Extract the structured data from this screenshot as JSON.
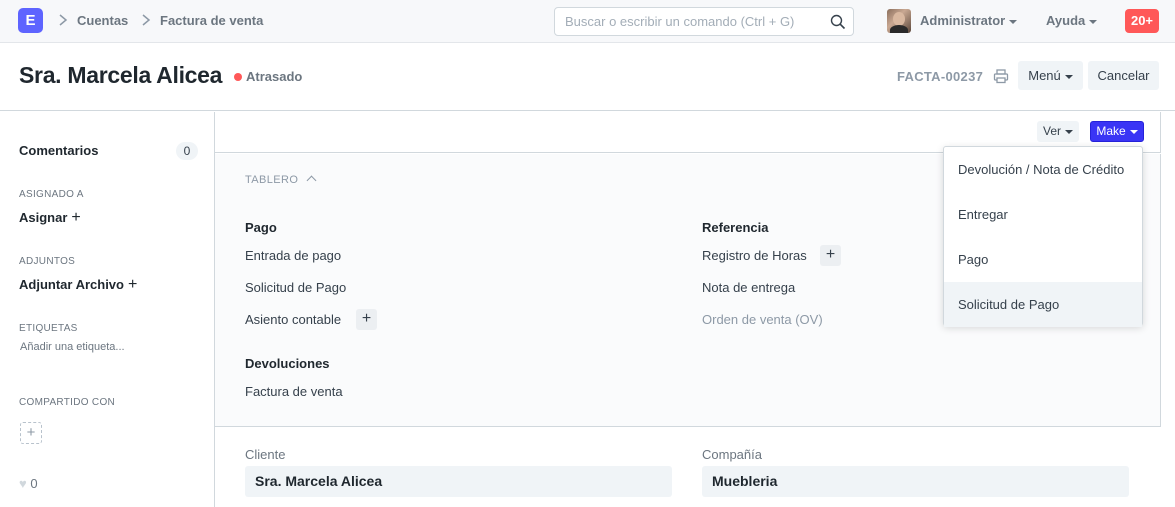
{
  "navbar": {
    "logo": "E",
    "breadcrumbs": [
      "Cuentas",
      "Factura de venta"
    ],
    "search_placeholder": "Buscar o escribir un comando (Ctrl + G)",
    "user": "Administrator",
    "help": "Ayuda",
    "notifications": "20+"
  },
  "page": {
    "title": "Sra. Marcela Alicea",
    "status": "Atrasado",
    "doc_id": "FACTA-00237",
    "menu_label": "Menú",
    "cancel_label": "Cancelar"
  },
  "sidebar": {
    "comments_label": "Comentarios",
    "comments_count": "0",
    "assigned_label": "ASIGNADO A",
    "assign_action": "Asignar",
    "attachments_label": "ADJUNTOS",
    "attach_action": "Adjuntar Archivo",
    "tags_label": "ETIQUETAS",
    "tags_placeholder": "Añadir una etiqueta...",
    "shared_label": "COMPARTIDO CON",
    "likes": "0"
  },
  "toolbar": {
    "view_label": "Ver",
    "make_label": "Make"
  },
  "dashboard": {
    "title": "TABLERO",
    "groups": [
      {
        "title": "Pago",
        "items": [
          "Entrada de pago",
          "Solicitud de Pago",
          "Asiento contable"
        ]
      },
      {
        "title": "Referencia",
        "items": [
          "Registro de Horas",
          "Nota de entrega",
          "Orden de venta (OV)"
        ]
      },
      {
        "title": "Devoluciones",
        "items": [
          "Factura de venta"
        ]
      }
    ]
  },
  "form": {
    "customer_label": "Cliente",
    "customer_value": "Sra. Marcela Alicea",
    "company_label": "Compañía",
    "company_value": "Muebleria"
  },
  "make_menu": {
    "items": [
      "Devolución / Nota de Crédito",
      "Entregar",
      "Pago",
      "Solicitud de Pago"
    ],
    "highlighted": "Solicitud de Pago"
  },
  "colors": {
    "brand": "#5e64ff",
    "primary_button": "#3a35f5",
    "status_red": "#ff5858"
  }
}
